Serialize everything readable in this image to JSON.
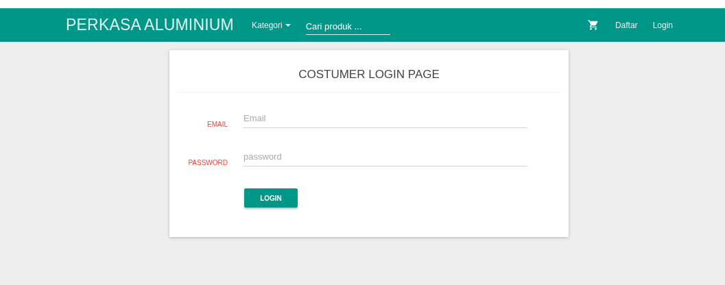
{
  "navbar": {
    "brand": "PERKASA ALUMINIUM",
    "menu": {
      "label": "Kategori"
    },
    "search": {
      "placeholder": "Cari produk ..."
    },
    "links": [
      "Daftar",
      "Login"
    ]
  },
  "card": {
    "title": "COSTUMER LOGIN PAGE",
    "fields": [
      {
        "label": "EMAIL",
        "placeholder": "Email"
      },
      {
        "label": "PASSWORD",
        "placeholder": "password"
      }
    ],
    "button": "LOGIN"
  }
}
